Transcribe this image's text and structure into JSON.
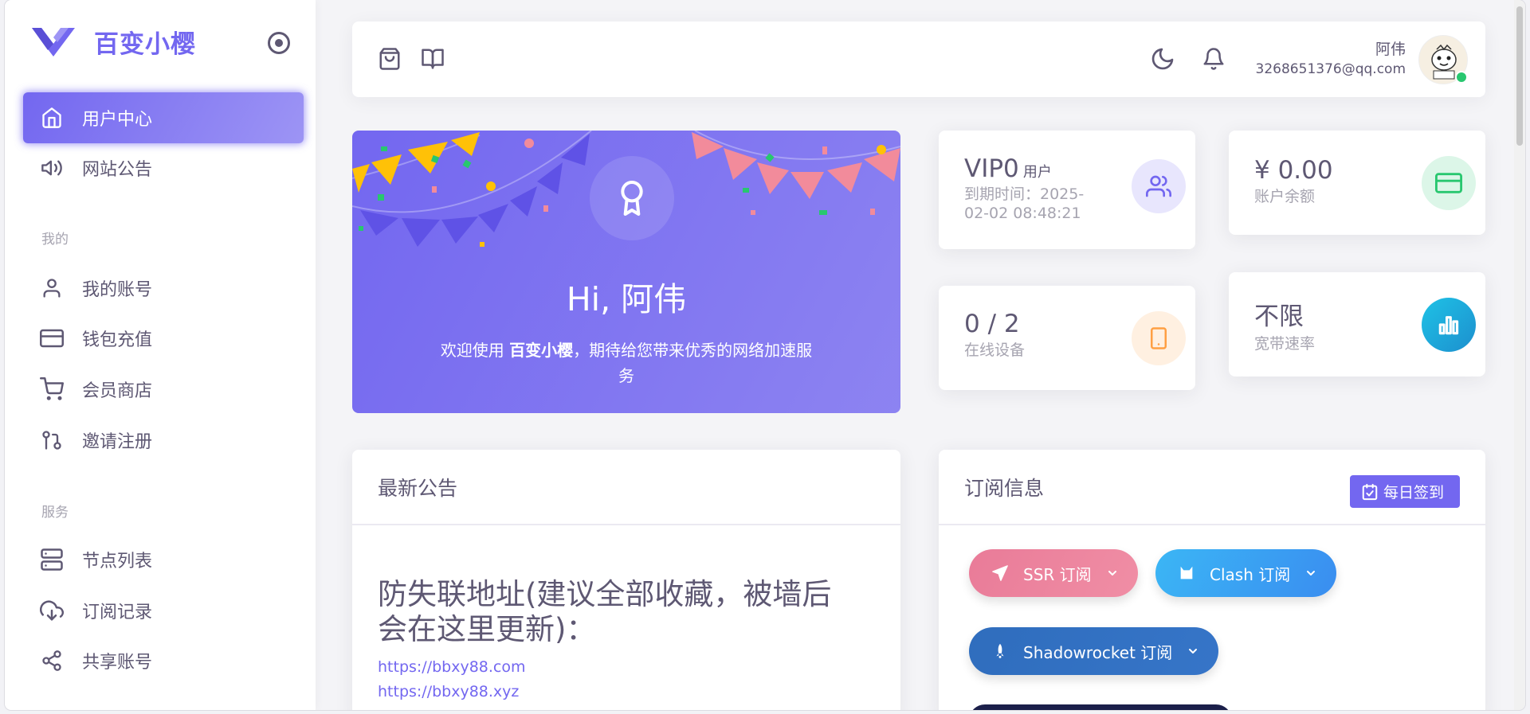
{
  "brand": {
    "name": "百变小樱",
    "logo_icon": "v-logo-icon",
    "accent": "#7367f0"
  },
  "sidebar": {
    "items_top": [
      {
        "label": "用户中心",
        "icon": "home-icon",
        "active": true
      },
      {
        "label": "网站公告",
        "icon": "speaker-icon"
      }
    ],
    "section_mine": "我的",
    "items_mine": [
      {
        "label": "我的账号",
        "icon": "user-icon"
      },
      {
        "label": "钱包充值",
        "icon": "credit-card-icon"
      },
      {
        "label": "会员商店",
        "icon": "shopping-cart-icon"
      },
      {
        "label": "邀请注册",
        "icon": "git-pull-icon"
      }
    ],
    "section_service": "服务",
    "items_service": [
      {
        "label": "节点列表",
        "icon": "server-icon"
      },
      {
        "label": "订阅记录",
        "icon": "download-cloud-icon"
      },
      {
        "label": "共享账号",
        "icon": "share-icon"
      }
    ]
  },
  "topbar": {
    "user_name": "阿伟",
    "user_email": "3268651376@qq.com",
    "status_color": "#28c76f"
  },
  "welcome": {
    "title": "Hi, 阿伟",
    "text_prefix": "欢迎使用 ",
    "text_brand": "百变小樱",
    "text_suffix": "，期待给您带来优秀的网络加速服务"
  },
  "stats": {
    "vip_level": "VIP0",
    "vip_suffix": "用户",
    "expire": "到期时间：2025-02-02 08:48:21",
    "balance": "¥ 0.00",
    "balance_label": "账户余额",
    "devices": "0 / 2",
    "devices_label": "在线设备",
    "bandwidth": "不限",
    "bandwidth_label": "宽带速率"
  },
  "notice": {
    "title": "最新公告",
    "heading": "防失联地址(建议全部收藏，被墙后会在这里更新)：",
    "links": [
      "https://bbxy88.com",
      "https://bbxy88.xyz"
    ]
  },
  "subscribe": {
    "title": "订阅信息",
    "checkin_label": "每日签到",
    "buttons": [
      {
        "label": "SSR 订阅",
        "icon": "send-icon",
        "color": "#ea5455"
      },
      {
        "label": "Clash 订阅",
        "icon": "cat-icon",
        "color": "#00cfe8"
      },
      {
        "label": "Shadowrocket 订阅",
        "icon": "rocket-icon",
        "color": "#1e6dc8"
      }
    ]
  }
}
